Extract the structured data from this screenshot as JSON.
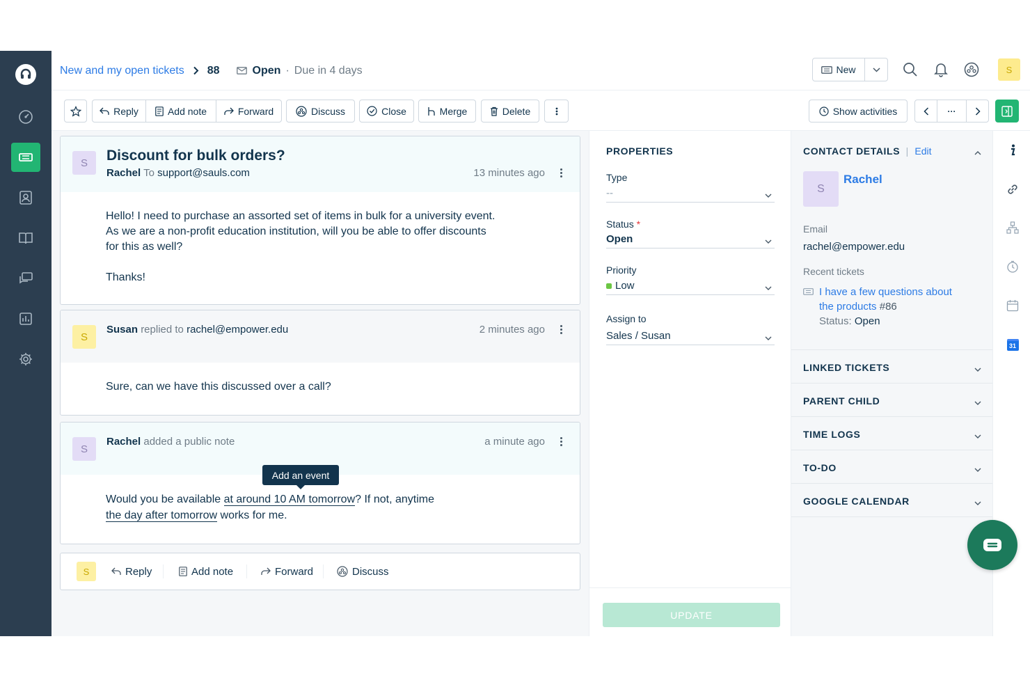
{
  "header": {
    "breadcrumb_link": "New and my open tickets",
    "ticket_id": "88",
    "status": "Open",
    "separator": "·",
    "due": "Due in 4 days",
    "new_label": "New",
    "user_initial": "S"
  },
  "toolbar": {
    "reply": "Reply",
    "add_note": "Add note",
    "forward": "Forward",
    "discuss": "Discuss",
    "close": "Close",
    "merge": "Merge",
    "delete": "Delete",
    "show_activities": "Show activities",
    "more": "···"
  },
  "conversation": {
    "subject": "Discount for bulk orders?",
    "messages": [
      {
        "initial": "S",
        "author": "Rachel",
        "action": "To",
        "target": "support@sauls.com",
        "time": "13 minutes ago",
        "body": [
          "Hello! I need to purchase an assorted set of items in bulk for a university event.",
          "As we are a non-profit education institution, will you be able to offer discounts",
          "for this as well?",
          "Thanks!"
        ]
      },
      {
        "initial": "S",
        "author": "Susan",
        "action": "replied to",
        "target": "rachel@empower.edu",
        "time": "2 minutes ago",
        "body": [
          "Sure, can we have this discussed over a call?"
        ]
      },
      {
        "initial": "S",
        "author": "Rachel",
        "action": "added a public note",
        "target": "",
        "time": "a minute ago",
        "body_parts": {
          "p1": "Would you be available ",
          "h1": "at around 10 AM tomorrow",
          "p2": "? If not, anytime",
          "h2": "the day after tomorrow",
          "p3": " works for me."
        }
      }
    ],
    "tooltip": "Add an event"
  },
  "reply_bar": {
    "initial": "S",
    "reply": "Reply",
    "add_note": "Add note",
    "forward": "Forward",
    "discuss": "Discuss"
  },
  "properties": {
    "title": "PROPERTIES",
    "type_label": "Type",
    "type_value": "--",
    "status_label": "Status",
    "required_mark": "*",
    "status_value": "Open",
    "priority_label": "Priority",
    "priority_value": "Low",
    "assign_label": "Assign to",
    "assign_value": "Sales / Susan",
    "update": "UPDATE"
  },
  "contact": {
    "title": "CONTACT DETAILS",
    "divider": "|",
    "edit": "Edit",
    "initial": "S",
    "name": "Rachel",
    "email_label": "Email",
    "email": "rachel@empower.edu",
    "recent_label": "Recent tickets",
    "recent_ticket_line1": "I have a few questions about",
    "recent_ticket_line2": "the products",
    "recent_ticket_id": "#86",
    "recent_status_label": "Status:",
    "recent_status": "Open",
    "sections": [
      "LINKED TICKETS",
      "PARENT CHILD",
      "TIME LOGS",
      "TO-DO",
      "GOOGLE CALENDAR"
    ]
  },
  "rail": {
    "calendar_day": "31"
  },
  "colors": {
    "sidebar": "#2c3e50",
    "accent_green": "#22b573",
    "link_blue": "#2c7be5",
    "priority_low": "#6cc644"
  }
}
